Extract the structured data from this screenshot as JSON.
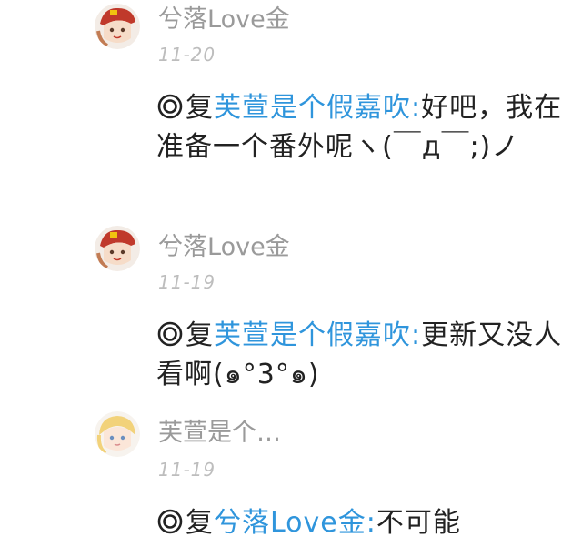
{
  "comments": [
    {
      "username": "兮落Love金",
      "date": "11-20",
      "reply_word": "复",
      "mention": "芙萱是个假嘉吹",
      "separator": ":",
      "text": "好吧，我在准备一个番外呢ヽ(￣д￣;)ノ",
      "avatar_icon": "anime-avatar-red-hat-icon"
    },
    {
      "username": "兮落Love金",
      "date": "11-19",
      "reply_word": "复",
      "mention": "芙萱是个假嘉吹",
      "separator": ":",
      "text": "更新又没人看啊(๑°3°๑)",
      "avatar_icon": "anime-avatar-red-hat-icon"
    },
    {
      "username": "芙萱是个…",
      "date": "11-19",
      "reply_word": "复",
      "mention": "兮落Love金",
      "separator": ":",
      "text": "不可能",
      "avatar_icon": "anime-avatar-blonde-icon"
    }
  ],
  "colors": {
    "mention": "#2f95dc",
    "username": "#9a9a9a",
    "date": "#bdbdbd",
    "text": "#222222"
  }
}
